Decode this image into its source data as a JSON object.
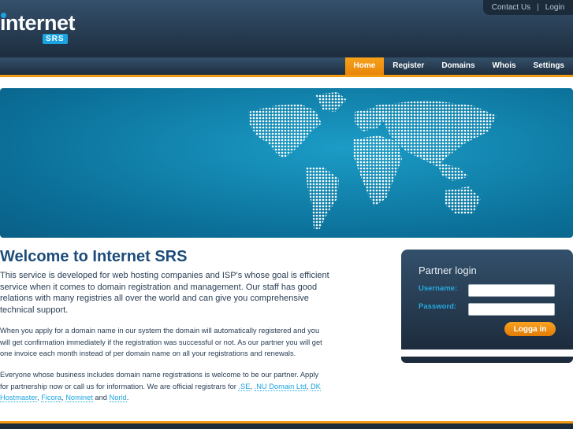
{
  "header": {
    "logo_word": "internet",
    "logo_badge": "SRS",
    "top_links": {
      "contact": "Contact Us",
      "separator": "|",
      "login": "Login"
    }
  },
  "nav": {
    "items": [
      {
        "label": "Home",
        "active": true
      },
      {
        "label": "Register"
      },
      {
        "label": "Domains"
      },
      {
        "label": "Whois"
      },
      {
        "label": "Settings"
      }
    ]
  },
  "main": {
    "title": "Welcome to Internet SRS",
    "p1": "This service is developed for web hosting companies and ISP's whose goal is efficient service when it comes to domain registration and management. Our staff has good relations with many registries all over the world and can give you comprehensive technical support.",
    "p2": "When you apply for a domain name in our system the domain will automatically registered and you will get confirmation immediately if the registration was successful or not. As our partner you will get one invoice each month instead of per domain name on all your registrations and renewals.",
    "p3_text": "Everyone whose business includes domain name registrations is welcome to be our partner. Apply for partnership now or call us for information. We are official registrars for ",
    "links": [
      ".SE",
      ".NU Domain Ltd",
      "DK Hostmaster",
      "Ficora",
      "Nominet",
      "Norid"
    ],
    "comma": ", ",
    "and": " and ",
    "period": "."
  },
  "login": {
    "title": "Partner login",
    "username_label": "Username:",
    "password_label": "Password:",
    "username_value": "",
    "password_value": "",
    "submit": "Logga in"
  },
  "colors": {
    "accent": "#f29a12",
    "link": "#1ba4e0",
    "header": "#1d2d3e"
  }
}
